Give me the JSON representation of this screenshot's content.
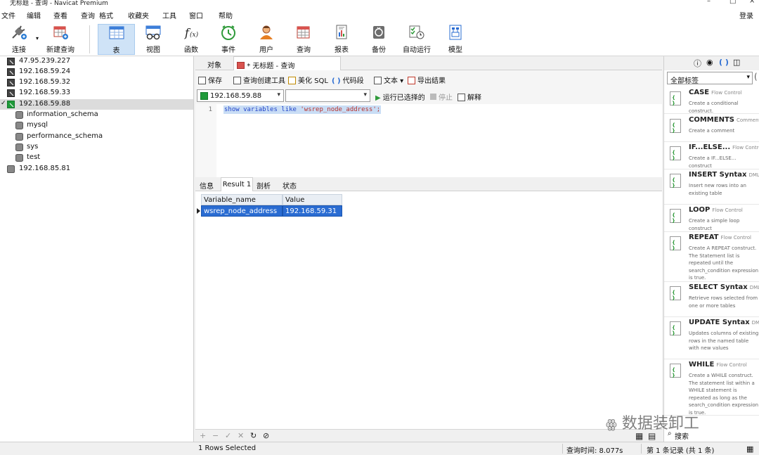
{
  "window": {
    "title": "无标题 - 查询 - Navicat Premium"
  },
  "menubar": {
    "items": [
      "文件",
      "编辑",
      "查看",
      "查询",
      "格式",
      "收藏夹",
      "工具",
      "窗口",
      "帮助"
    ],
    "login": "登录"
  },
  "toolbar": {
    "buttons": [
      {
        "label": "连接",
        "icon": "plug-icon"
      },
      {
        "label": "新建查询",
        "icon": "new-query-icon"
      },
      {
        "label": "表",
        "icon": "table-icon"
      },
      {
        "label": "视图",
        "icon": "view-icon"
      },
      {
        "label": "函数",
        "icon": "function-icon"
      },
      {
        "label": "事件",
        "icon": "clock-icon"
      },
      {
        "label": "用户",
        "icon": "user-icon"
      },
      {
        "label": "查询",
        "icon": "query-icon"
      },
      {
        "label": "报表",
        "icon": "report-icon"
      },
      {
        "label": "备份",
        "icon": "backup-icon"
      },
      {
        "label": "自动运行",
        "icon": "autorun-icon"
      },
      {
        "label": "模型",
        "icon": "model-icon"
      }
    ]
  },
  "tree": {
    "connections": [
      {
        "label": "47.95.239.227"
      },
      {
        "label": "192.168.59.24"
      },
      {
        "label": "192.168.59.32"
      },
      {
        "label": "192.168.59.33"
      },
      {
        "label": "192.168.59.88"
      }
    ],
    "databases": [
      "information_schema",
      "mysql",
      "performance_schema",
      "sys",
      "test"
    ],
    "last_connection": "192.168.85.81"
  },
  "tabs": {
    "objects": "对象",
    "query": "* 无标题 - 查询"
  },
  "query_toolbar": {
    "save": "保存",
    "builder": "查询创建工具",
    "beautify": "美化 SQL",
    "snippet": "代码段",
    "text": "文本",
    "export": "导出结果"
  },
  "connection_row": {
    "connection": "192.168.59.88",
    "database": "",
    "run": "运行已选择的",
    "stop": "停止",
    "explain": "解释"
  },
  "editor": {
    "line": "1",
    "sql_keywords": "show variables like ",
    "sql_string": "'wsrep_node_address';"
  },
  "result_tabs": [
    "信息",
    "Result 1",
    "剖析",
    "状态"
  ],
  "grid": {
    "columns": [
      "Variable_name",
      "Value"
    ],
    "rows": [
      [
        "wsrep_node_address",
        "192.168.59.31"
      ]
    ]
  },
  "right_panel": {
    "tag_filter": "全部标签",
    "snippets": [
      {
        "name": "CASE",
        "category": "Flow Control",
        "desc": "Create a conditional construct."
      },
      {
        "name": "COMMENTS",
        "category": "Comment",
        "desc": "Create a comment"
      },
      {
        "name": "IF...ELSE...",
        "category": "Flow Control",
        "desc": "Create a IF...ELSE... construct"
      },
      {
        "name": "INSERT Syntax",
        "category": "DML",
        "desc": "Insert new rows into an existing table"
      },
      {
        "name": "LOOP",
        "category": "Flow Control",
        "desc": "Create a simple loop construct"
      },
      {
        "name": "REPEAT",
        "category": "Flow Control",
        "desc": "Create A REPEAT construct. The Statement list is repeated until the search_condition expression is true."
      },
      {
        "name": "SELECT Syntax",
        "category": "DML",
        "desc": "Retrieve rows selected from one or more tables"
      },
      {
        "name": "UPDATE Syntax",
        "category": "DML",
        "desc": "Updates columns of existing rows in the named table with new values"
      },
      {
        "name": "WHILE",
        "category": "Flow Control",
        "desc": "Create a WHILE construct. The statement list within a WHILE statement is repeated as long as the search_condition expression is true."
      }
    ],
    "search": "搜索",
    "watermark": "数据装卸工"
  },
  "statusbar": {
    "selected": "1 Rows Selected",
    "query_time": "查询时间: 8.077s",
    "record": "第 1 条记录 (共 1 条)"
  }
}
